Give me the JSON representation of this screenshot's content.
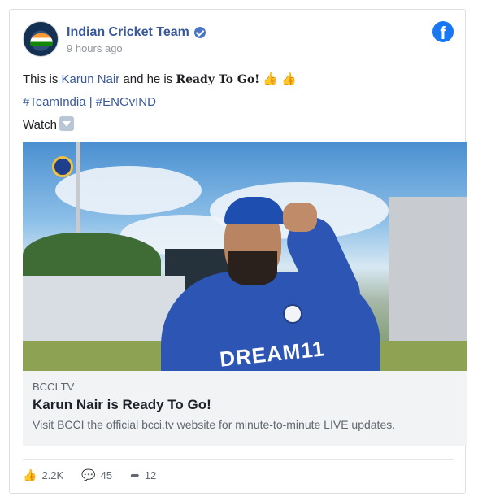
{
  "post": {
    "page_name": "Indian Cricket Team",
    "time": "9 hours ago",
    "text_line1": {
      "prefix": "This is ",
      "mention": "Karun Nair",
      "middle": " and he is ",
      "bold": "Ready To Go!",
      "emoji1": "👍",
      "emoji2": "👍"
    },
    "hashtag1": "#TeamIndia",
    "separator": " | ",
    "hashtag2": "#ENGvIND",
    "watch_label": "Watch"
  },
  "link_preview": {
    "domain": "BCCI.TV",
    "title": "Karun Nair is Ready To Go!",
    "description": "Visit BCCI the official bcci.tv website for minute-to-minute LIVE updates."
  },
  "media": {
    "jersey_text": "DREAM11"
  },
  "stats": {
    "likes": "2.2K",
    "comments": "45",
    "shares": "12"
  },
  "icons": {
    "facebook": "f",
    "like": "👍",
    "comment": "💬",
    "share": "➦"
  },
  "colors": {
    "brand_blue": "#385898",
    "facebook_blue": "#1877f2",
    "preview_bg": "#f2f3f5"
  }
}
